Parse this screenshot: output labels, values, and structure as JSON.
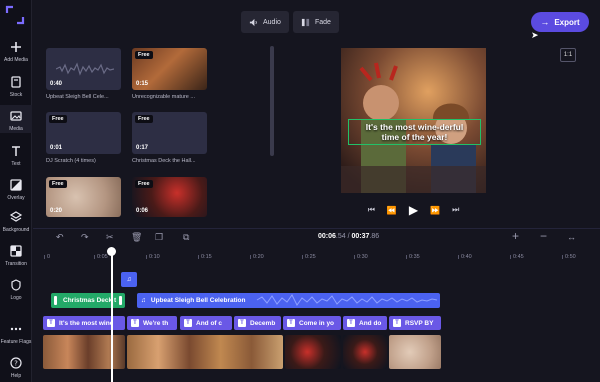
{
  "toolbar": {
    "audio_label": "Audio",
    "fade_label": "Fade",
    "export_label": "Export",
    "aspect_ratio": "1:1"
  },
  "sidebar": {
    "items": [
      {
        "label": "Add Media",
        "icon": "plus-icon"
      },
      {
        "label": "Stock",
        "icon": "stock-icon"
      },
      {
        "label": "Media",
        "icon": "media-icon"
      },
      {
        "label": "Text",
        "icon": "text-icon"
      },
      {
        "label": "Overlay",
        "icon": "overlay-icon"
      },
      {
        "label": "Background",
        "icon": "layers-icon"
      },
      {
        "label": "Transition",
        "icon": "transition-icon"
      },
      {
        "label": "Logo",
        "icon": "shield-icon"
      },
      {
        "label": "Feature Flags",
        "icon": "more-icon"
      },
      {
        "label": "Help",
        "icon": "help-icon"
      }
    ]
  },
  "media": {
    "tiles": [
      {
        "badge": "",
        "duration": "0:40",
        "caption": "Upbeat Sleigh Bell Cele...",
        "kind": "audio"
      },
      {
        "badge": "Free",
        "duration": "0:15",
        "caption": "Unrecognizable mature ...",
        "kind": "video"
      },
      {
        "badge": "Free",
        "duration": "0:01",
        "caption": "DJ Scratch (4 times)",
        "kind": "audio"
      },
      {
        "badge": "Free",
        "duration": "0:17",
        "caption": "Christmas Deck the Hall...",
        "kind": "audio"
      },
      {
        "badge": "Free",
        "duration": "0:20",
        "caption": "",
        "kind": "video"
      },
      {
        "badge": "Free",
        "duration": "0:06",
        "caption": "",
        "kind": "video"
      }
    ]
  },
  "preview": {
    "caption_line1": "It's the most wine-derful",
    "caption_line2": "time of the year!"
  },
  "timeline": {
    "current_time_main": "00:06",
    "current_time_frac": ".54",
    "separator": " / ",
    "total_time_main": "00:37",
    "total_time_frac": ".86",
    "ruler_ticks": [
      "0",
      "0:05",
      "0:10",
      "0:15",
      "0:20",
      "0:25",
      "0:30",
      "0:35",
      "0:40",
      "0:45",
      "0:50",
      "0:55"
    ],
    "audio_clips": [
      {
        "label": "Christmas Deck t",
        "color": "#23a968"
      },
      {
        "label": "Upbeat Sleigh Bell Celebration",
        "color": "#4b62f0"
      }
    ],
    "text_clips": [
      "It's the most wine",
      "We're th",
      "And of c",
      "Decemb",
      "Come in yo",
      "And do",
      "RSVP BY"
    ]
  },
  "colors": {
    "accent": "#5b4be0",
    "background": "#15151f",
    "audio_track": "#4b62f0",
    "text_track": "#6a58e6",
    "selection": "#22c068"
  }
}
